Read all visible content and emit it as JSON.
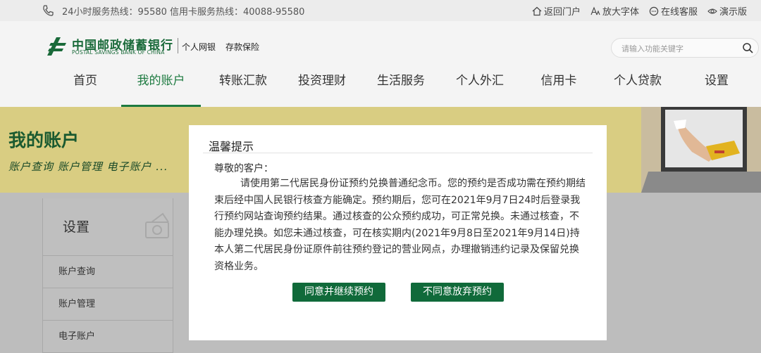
{
  "topbar": {
    "hotline": "24小时服务热线：95580",
    "credit_hotline": "信用卡服务热线：40088-95580",
    "links": [
      "返回门户",
      "放大字体",
      "在线客服",
      "演示版"
    ]
  },
  "header": {
    "bank_name_cn": "中国邮政储蓄银行",
    "bank_name_en": "POSTAL SAVINGS BANK OF CHINA",
    "channel": "个人网银",
    "product": "存款保险",
    "search_placeholder": "请输入功能关键字"
  },
  "nav": {
    "items": [
      "首页",
      "我的账户",
      "转账汇款",
      "投资理财",
      "生活服务",
      "个人外汇",
      "信用卡",
      "个人贷款",
      "设置"
    ],
    "active": "我的账户"
  },
  "banner": {
    "title": "我的账户",
    "subtitle": "账户查询 账户管理 电子账户 ..."
  },
  "sidebar": {
    "heading": "设置",
    "items": [
      "账户查询",
      "账户管理",
      "电子账户"
    ]
  },
  "dialog": {
    "title": "温馨提示",
    "greeting": "尊敬的客户：",
    "body": "请使用第二代居民身份证预约兑换普通纪念币。您的预约是否成功需在预约期结束后经中国人民银行核查方能确定。预约期后，您可在2021年9月7日24时后登录我行预约网站查询预约结果。通过核查的公众预约成功，可正常兑换。未通过核查，不能办理兑换。如您未通过核查，可在核实期内(2021年9月8日至2021年9月14日)持本人第二代居民身份证原件前往预约登记的营业网点，办理撤销违约记录及保留兑换资格业务。",
    "agree_label": "同意并继续预约",
    "decline_label": "不同意放弃预约"
  },
  "colors": {
    "brand_green": "#106a3a",
    "banner_bg": "#d9cd82",
    "overlay_gray": "#bfbfbf"
  },
  "icons": [
    "phone-icon",
    "home-icon",
    "font-size-icon",
    "chat-icon",
    "eye-icon",
    "search-icon",
    "logo-icon"
  ]
}
